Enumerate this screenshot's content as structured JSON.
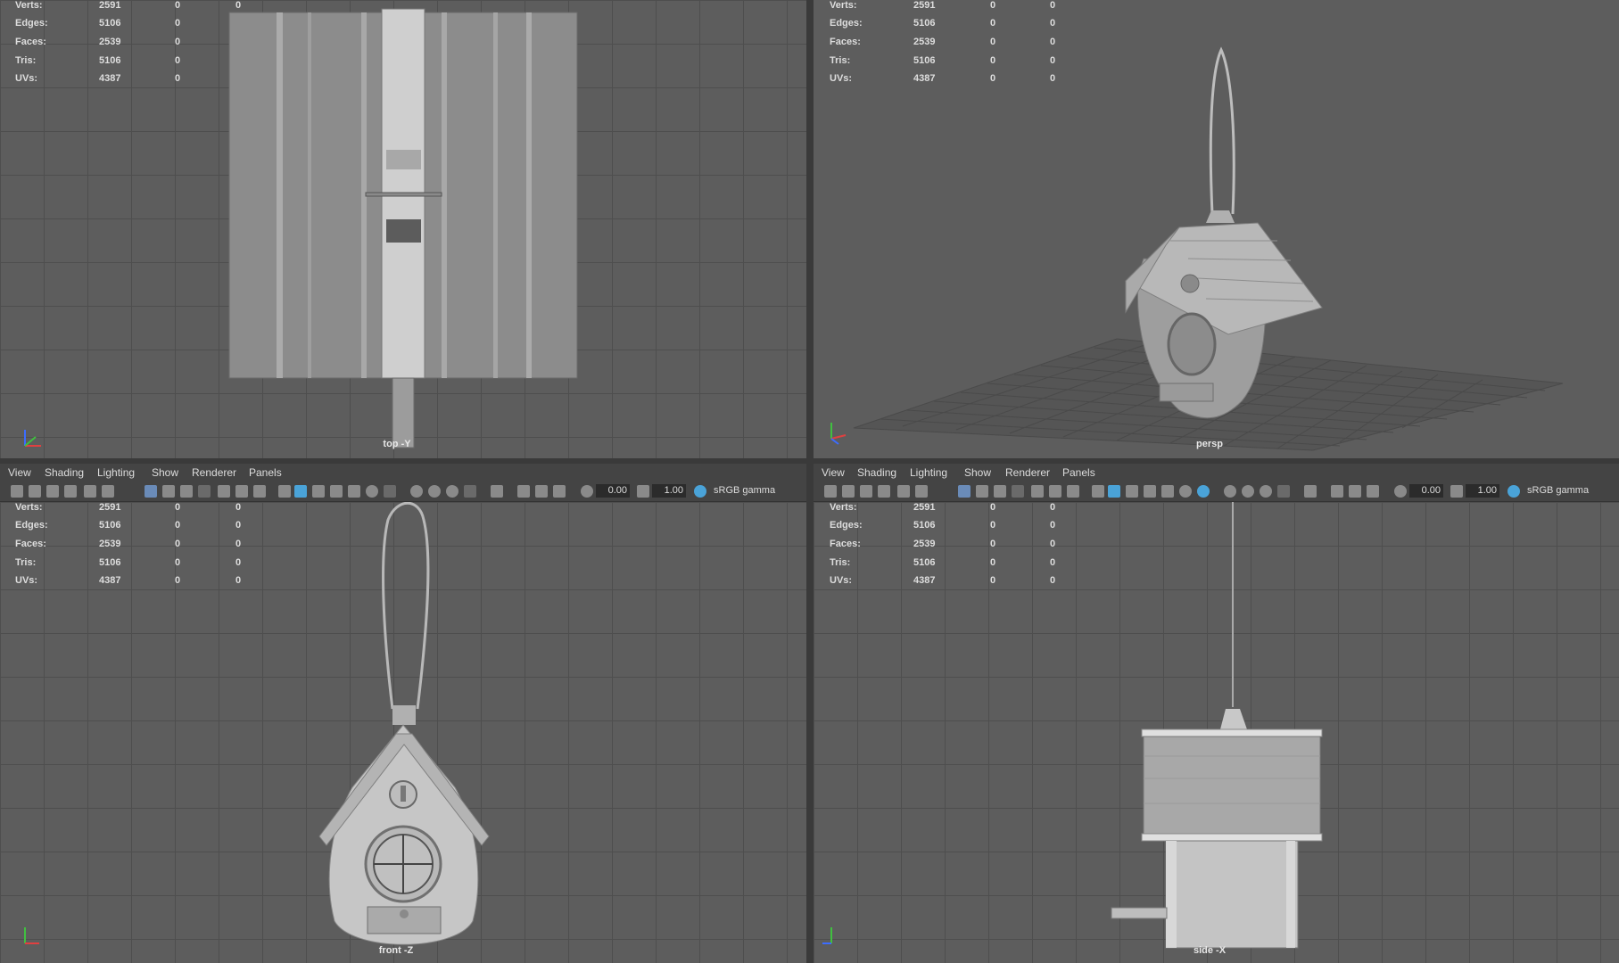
{
  "menu": {
    "view": "View",
    "shading": "Shading",
    "lighting": "Lighting",
    "show": "Show",
    "renderer": "Renderer",
    "panels": "Panels"
  },
  "hud": {
    "verts": {
      "label": "Verts:",
      "value": "2591",
      "sel": "0",
      "extra": "0"
    },
    "edges": {
      "label": "Edges:",
      "value": "5106",
      "sel": "0",
      "extra": "0"
    },
    "faces": {
      "label": "Faces:",
      "value": "2539",
      "sel": "0",
      "extra": "0"
    },
    "tris": {
      "label": "Tris:",
      "value": "5106",
      "sel": "0",
      "extra": "0"
    },
    "uvs": {
      "label": "UVs:",
      "value": "4387",
      "sel": "0",
      "extra": "0"
    }
  },
  "toolbar": {
    "exposure": "0.00",
    "gamma": "1.00",
    "colorspace": "sRGB gamma"
  },
  "cameras": {
    "top": "top -Y",
    "persp": "persp",
    "front": "front -Z",
    "side": "side -X"
  },
  "colors": {
    "viewport_bg": "#5d5d5d",
    "grid": "#4e4e4e",
    "panel": "#444444",
    "active_icon": "#4aa3d8"
  }
}
